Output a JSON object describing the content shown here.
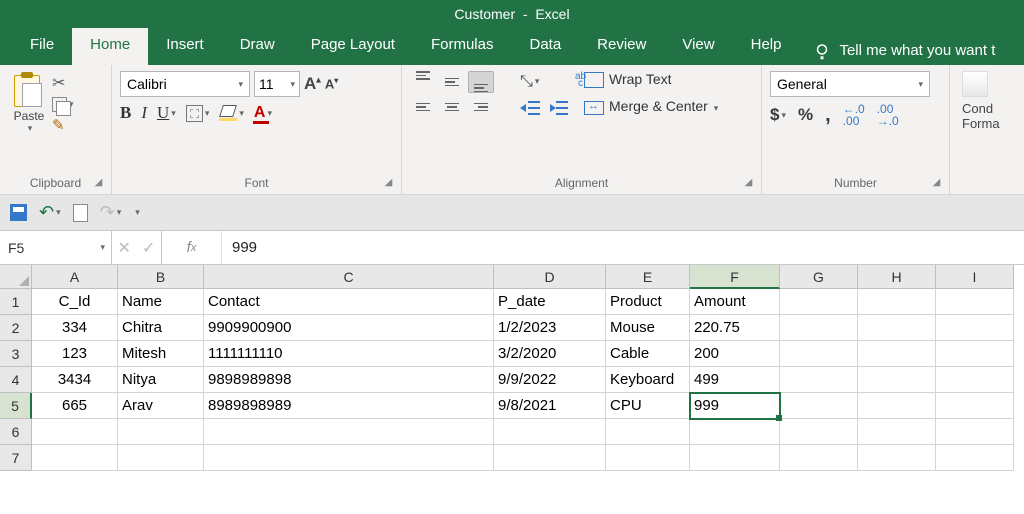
{
  "title": {
    "doc": "Customer",
    "app": "Excel"
  },
  "tabs": [
    "File",
    "Home",
    "Insert",
    "Draw",
    "Page Layout",
    "Formulas",
    "Data",
    "Review",
    "View",
    "Help"
  ],
  "active_tab": "Home",
  "tellme": "Tell me what you want t",
  "ribbon": {
    "clipboard_label": "Clipboard",
    "paste_label": "Paste",
    "font_label": "Font",
    "font_name": "Calibri",
    "font_size": "11",
    "alignment_label": "Alignment",
    "wrap_text": "Wrap Text",
    "merge_center": "Merge & Center",
    "number_label": "Number",
    "number_format": "General",
    "cond_label_1": "Cond",
    "cond_label_2": "Forma"
  },
  "namebox": "F5",
  "formula_value": "999",
  "columns": [
    "A",
    "B",
    "C",
    "D",
    "E",
    "F",
    "G",
    "H",
    "I"
  ],
  "col_widths": [
    "cA",
    "cB",
    "cC",
    "cD",
    "cE",
    "cF",
    "cG",
    "cH",
    "cI"
  ],
  "selected_col": "F",
  "selected_row": 5,
  "active_cell": {
    "row": 5,
    "col": "F"
  },
  "grid": {
    "headers": [
      "C_Id",
      "Name",
      "Contact",
      "P_date",
      "Product",
      "Amount"
    ],
    "rows": [
      {
        "C_Id": "334",
        "Name": "Chitra",
        "Contact": "9909900900",
        "P_date": "1/2/2023",
        "Product": "Mouse",
        "Amount": "220.75"
      },
      {
        "C_Id": "123",
        "Name": "Mitesh",
        "Contact": "1111111110",
        "P_date": "3/2/2020",
        "Product": "Cable",
        "Amount": "200"
      },
      {
        "C_Id": "3434",
        "Name": "Nitya",
        "Contact": "9898989898",
        "P_date": "9/9/2022",
        "Product": "Keyboard",
        "Amount": "499"
      },
      {
        "C_Id": "665",
        "Name": "Arav",
        "Contact": "8989898989",
        "P_date": "9/8/2021",
        "Product": "CPU",
        "Amount": "999"
      }
    ],
    "total_rows_shown": 7
  }
}
